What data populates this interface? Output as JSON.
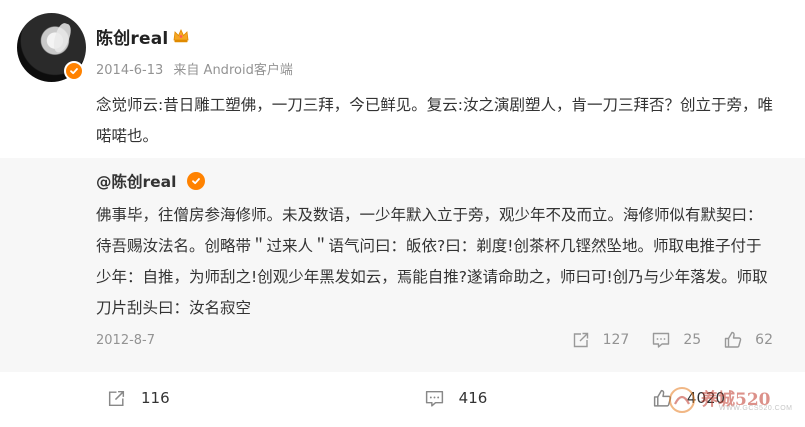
{
  "post": {
    "author": "陈创real",
    "date": "2014-6-13",
    "source": "来自 Android客户端",
    "text": "念觉师云:昔日雕工塑佛，一刀三拜，今已鲜见。复云:汝之演剧塑人，肯一刀三拜否？创立于旁，唯喏喏也。"
  },
  "repost": {
    "author": "@陈创real",
    "text": "佛事毕，往僧房参海修师。未及数语，一少年默入立于旁，观少年不及而立。海修师似有默契曰：待吾赐汝法名。创略带＂过来人＂语气问曰：皈依?曰：剃度!创茶杯几铿然坠地。师取电推子付于少年：自推，为师刮之!创观少年黑发如云，焉能自推?遂请命助之，师曰可!创乃与少年落发。师取刀片刮头曰：汝名寂空",
    "date": "2012-8-7",
    "stats": {
      "reposts": "127",
      "comments": "25",
      "likes": "62"
    }
  },
  "footer": {
    "reposts": "116",
    "comments": "416",
    "likes": "4020"
  },
  "watermark": {
    "text": "养城520",
    "sub": "WWW.GCS520.COM"
  },
  "colors": {
    "accent": "#ff8200",
    "meta": "#939393",
    "repost_bg": "#f7f7f7"
  },
  "icons": [
    "verified-badge-icon",
    "crown-icon",
    "repost-icon",
    "comment-icon",
    "like-icon"
  ]
}
